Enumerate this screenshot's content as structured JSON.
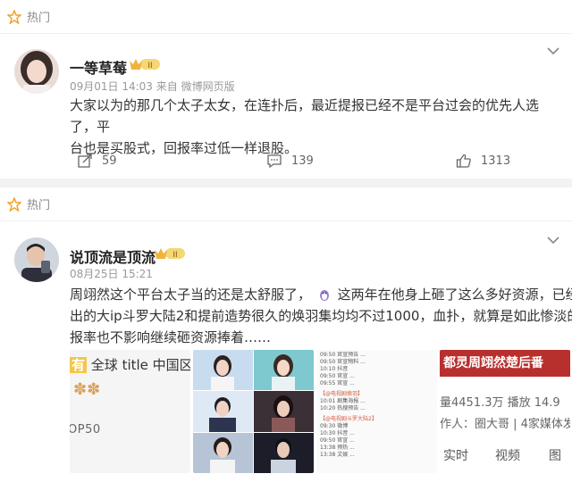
{
  "posts": [
    {
      "section_label": "热门",
      "username": "一等草莓",
      "badge": "II",
      "meta": "09月01日 14:03 来自 微博网页版",
      "content": "大家以为的那几个太子太女，在连扑后，最近提报已经不是平台过会的优先人选了，平台也是买股式，回报率过低一样退股。",
      "line1": "大家以为的那几个太子太女，在连扑后，最近提报已经不是平台过会的优先人选了，平",
      "line2": "台也是买股式，回报率过低一样退股。",
      "repost_count": "59",
      "comment_count": "139",
      "like_count": "1313"
    },
    {
      "section_label": "热门",
      "username": "说顶流是顶流",
      "badge": "II",
      "meta": "08月25日 15:21",
      "line1a": "周翊然这个平台太子当的还是太舒服了，",
      "line1b": "这两年在他身上砸了这么多好资源，已经播",
      "line2": "出的大ip斗罗大陆2和提前造势很久的焕羽集均均不过1000，血扑，就算是如此惨淡的回",
      "line3": "报率也不影响继续砸资源捧着……",
      "thumbs": {
        "t1_title_prefix": "有",
        "t1_title": "全球 title 中国区",
        "t1_op50": "OP50",
        "t3_lines": [
          "09:50 官宣预告 ...",
          "09:50 官宣物料 ...",
          "10:10 抖音",
          "09:50 官宣 ...",
          "09:55 官宣 ...",
          "【@电视剧焕羽】",
          "10:01 剧集海报 ...",
          "10:20 热搜预告 ...",
          "【@电视剧斗罗大陆2】",
          "09:30 微博",
          "10:30 抖音 ...",
          "09:50 官宣 ...",
          "13:38 预热 ...",
          "13:38 文娱 ..."
        ],
        "t4_title": "都灵周翊然楚后番",
        "t4_stat1": "量4451.3万  播放 14.9",
        "t4_stat2": "作人：圈大哥 | 4家媒体发",
        "t4_tabs": [
          "实时",
          "视频",
          "图"
        ]
      }
    }
  ]
}
